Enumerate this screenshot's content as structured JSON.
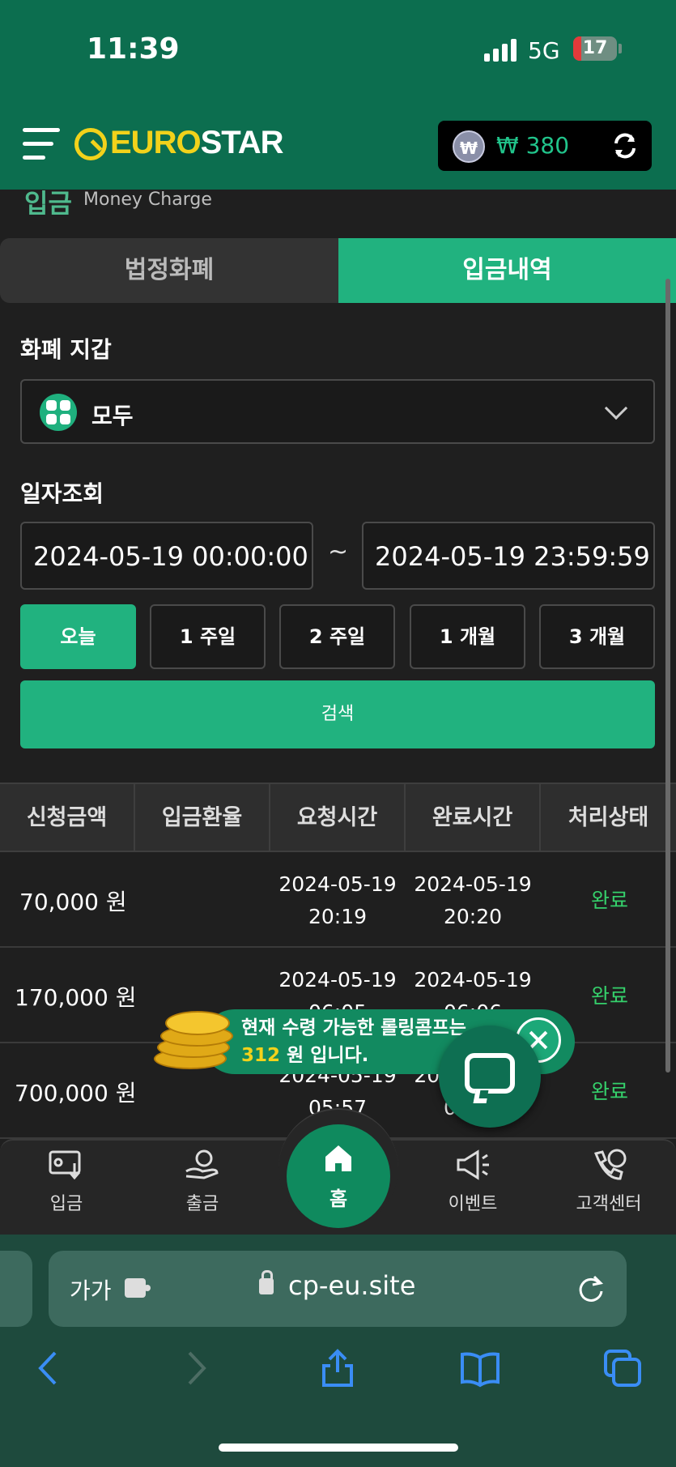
{
  "status": {
    "time": "11:39",
    "network": "5G",
    "battery": "17"
  },
  "header": {
    "brand_euro": "EURO",
    "brand_star": "STAR",
    "wallet_symbol": "₩",
    "wallet_amount": "₩ 380"
  },
  "page": {
    "title_ko": "입금",
    "title_en": "Money Charge"
  },
  "tabs": [
    {
      "label": "법정화폐"
    },
    {
      "label": "입금내역"
    }
  ],
  "filter": {
    "wallet_label": "화폐 지갑",
    "wallet_value": "모두",
    "date_label": "일자조회",
    "date_from": "2024-05-19 00:00:00",
    "date_sep": "~",
    "date_to": "2024-05-19 23:59:59",
    "quick": [
      "오늘",
      "1 주일",
      "2 주일",
      "1 개월",
      "3 개월"
    ],
    "search_label": "검색"
  },
  "table": {
    "headers": [
      "신청금액",
      "입금환율",
      "요청시간",
      "완료시간",
      "처리상태"
    ],
    "rows": [
      {
        "amount": "70,000 원",
        "req_date": "2024-05-19",
        "req_time": "20:19",
        "done_date": "2024-05-19",
        "done_time": "20:20",
        "status": "완료"
      },
      {
        "amount": "170,000 원",
        "req_date": "2024-05-19",
        "req_time": "06:05",
        "done_date": "2024-05-19",
        "done_time": "06:06",
        "status": "완료"
      },
      {
        "amount": "700,000 원",
        "req_date": "2024-05-19",
        "req_time": "05:57",
        "done_date": "2024-05-19",
        "done_time": "05:58",
        "status": "완료"
      }
    ]
  },
  "toast": {
    "text_pre": "현재 수령 가능한 롤링콤프는 ",
    "highlight": "312",
    "text_post": " 원 입니다."
  },
  "nav": [
    {
      "label": "입금"
    },
    {
      "label": "출금"
    },
    {
      "label": "홈"
    },
    {
      "label": "이벤트"
    },
    {
      "label": "고객센터"
    }
  ],
  "browser": {
    "text_size": "가가",
    "url": "cp-eu.site"
  },
  "colors": {
    "brand": "#0c6e4f",
    "accent": "#21b27f",
    "logo": "#f2d21b",
    "status_done": "#35d06b"
  }
}
